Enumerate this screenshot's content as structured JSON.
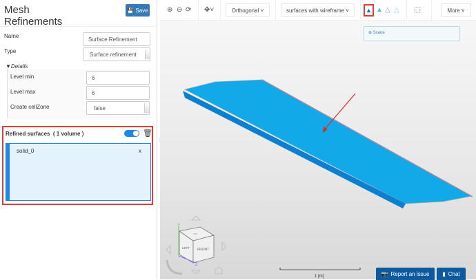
{
  "panel": {
    "title_line1": "Mesh",
    "title_line2": "Refinements",
    "save_label": "Save",
    "name_label": "Name",
    "name_value": "Surface Refinement",
    "type_label": "Type",
    "type_value": "Surface refinement",
    "details_label": "Details",
    "level_min_label": "Level min",
    "level_min_value": "6",
    "level_max_label": "Level max",
    "level_max_value": "6",
    "cellzone_label": "Create cellZone",
    "cellzone_value": "false",
    "refined_label": "Refined surfaces",
    "refined_count": "( 1 volume )",
    "toggle_on": true,
    "items": [
      {
        "name": "solid_0",
        "remove": "x"
      }
    ]
  },
  "toolbar": {
    "projection": "Orthogonal",
    "render_mode": "surfaces with wireframe",
    "more": "More"
  },
  "viewer": {
    "scene_label": "Scene",
    "scale_label": "1 [m]",
    "cube": {
      "top": "TOP",
      "left": "LEFT",
      "front": "FRONT",
      "y": "Y",
      "z": "Z"
    }
  },
  "footer": {
    "report": "Report an issue",
    "chat": "Chat"
  },
  "colors": {
    "accent": "#1e88e5",
    "highlight": "#e53935",
    "model": "#12a9e8",
    "button": "#0d5a9e"
  }
}
